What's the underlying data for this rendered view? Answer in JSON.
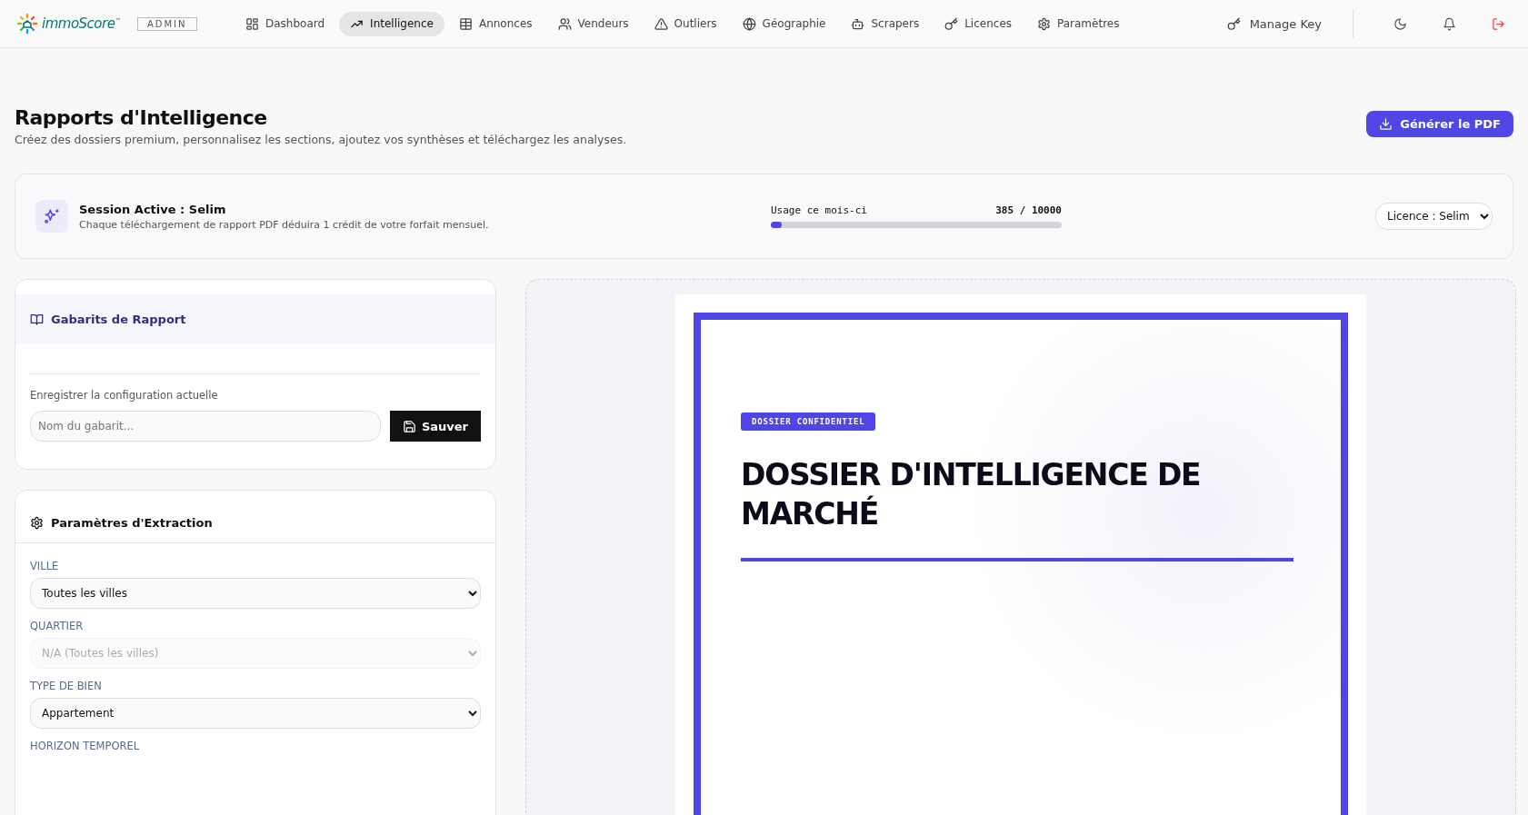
{
  "header": {
    "logo": "immoScore",
    "logo_mark": "™",
    "role_badge": "ADMIN",
    "nav": [
      {
        "label": "Dashboard",
        "selected": false
      },
      {
        "label": "Intelligence",
        "selected": true
      },
      {
        "label": "Annonces",
        "selected": false
      },
      {
        "label": "Vendeurs",
        "selected": false
      },
      {
        "label": "Outliers",
        "selected": false
      },
      {
        "label": "Géographie",
        "selected": false
      },
      {
        "label": "Scrapers",
        "selected": false
      },
      {
        "label": "Licences",
        "selected": false
      },
      {
        "label": "Paramètres",
        "selected": false
      }
    ],
    "manage_key": "Manage Key"
  },
  "page": {
    "title": "Rapports d'Intelligence",
    "subtitle": "Créez des dossiers premium, personnalisez les sections, ajoutez vos synthèses et téléchargez les analyses.",
    "generate_button": "Générer le PDF"
  },
  "session": {
    "title": "Session Active : Selim",
    "description": "Chaque téléchargement de rapport PDF déduira 1 crédit de votre forfait mensuel.",
    "usage_label": "Usage ce mois-ci",
    "usage_reading": "385 / 10000",
    "level": 0.0385,
    "license_select": "Licence : Selim"
  },
  "templates": {
    "title": "Gabarits de Rapport",
    "save_label": "Enregistrer la configuration actuelle",
    "name_placeholder": "Nom du gabarit...",
    "save_button": "Sauver"
  },
  "extraction": {
    "title": "Paramètres d'Extraction",
    "fields": [
      {
        "label": "VILLE",
        "value": "Toutes les villes",
        "disabled": false
      },
      {
        "label": "QUARTIER",
        "value": "N/A (Toutes les villes)",
        "disabled": true
      },
      {
        "label": "TYPE DE BIEN",
        "value": "Appartement",
        "disabled": false
      },
      {
        "label": "HORIZON TEMPOREL"
      }
    ]
  },
  "preview": {
    "badge": "DOSSIER CONFIDENTIEL",
    "title": "DOSSIER D'INTELLIGENCE DE MARCHÉ"
  }
}
